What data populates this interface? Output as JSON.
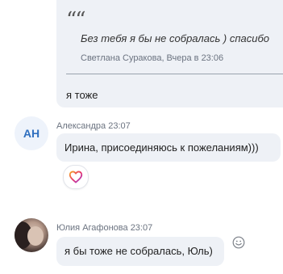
{
  "thread": {
    "quoted_message": {
      "quote_glyph": "66",
      "text": "Без тебя я бы не собралась ) спасибо",
      "meta": "Светлана Суракова, Вчера в 23:06"
    },
    "reply_text": "я тоже"
  },
  "messages": [
    {
      "sender_initials": "АН",
      "sender_name": "Александра",
      "time": "23:07",
      "text": "Ирина, присоединяюсь к пожеланиям)))",
      "reaction_icon": "heart-icon"
    },
    {
      "sender_name": "Юлия Агафонова",
      "time": "23:07",
      "text": "я бы тоже не собралась, Юль)"
    }
  ],
  "colors": {
    "bubble": "#eef1f6",
    "initials_text": "#2f6fbf",
    "meta_text": "#6b7380"
  }
}
